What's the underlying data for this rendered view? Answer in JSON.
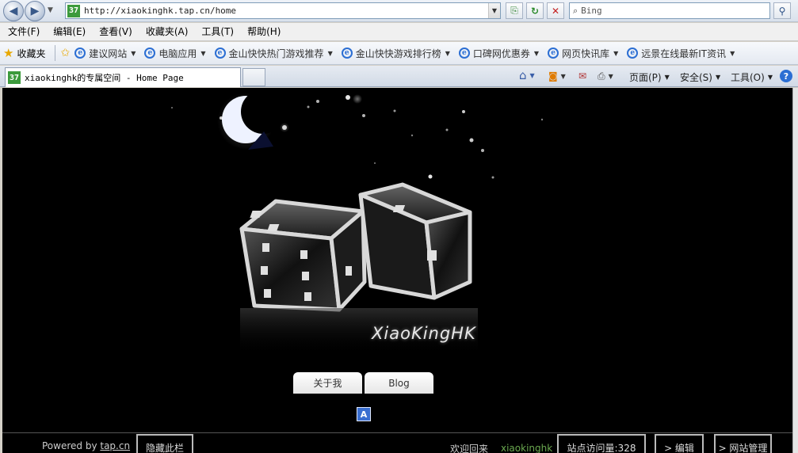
{
  "browser": {
    "url": "http://xiaokinghk.tap.cn/home",
    "favicon_text": "37",
    "search_placeholder": "Bing",
    "menu": [
      "文件(F)",
      "编辑(E)",
      "查看(V)",
      "收藏夹(A)",
      "工具(T)",
      "帮助(H)"
    ],
    "favorites_label": "收藏夹",
    "favorites": [
      "建议网站",
      "电脑应用",
      "金山快快热门游戏推荐",
      "金山快快游戏排行榜",
      "口碑网优惠券",
      "网页快讯库",
      "远景在线最新IT资讯"
    ],
    "tab_title": "xiaokinghk的专属空间 - Home Page",
    "commands": {
      "page": "页面(P)",
      "safety": "安全(S)",
      "tools": "工具(O)"
    }
  },
  "site": {
    "logo_text": "XiaoKingHK",
    "nav": [
      "关于我",
      "Blog"
    ],
    "a_icon": "A"
  },
  "footer": {
    "powered_prefix": "Powered by ",
    "powered_link": "tap.cn",
    "hide_button": "隐藏此栏",
    "welcome": "欢迎回来",
    "username": "xiaokinghk",
    "visits": "站点访问量:328",
    "edit": "> 编辑",
    "admin": "> 网站管理"
  },
  "colors": {
    "page_bg": "#000000",
    "username": "#6aa84f",
    "ie_blue": "#2b6ed3",
    "favicon_green": "#3c9a3c"
  }
}
